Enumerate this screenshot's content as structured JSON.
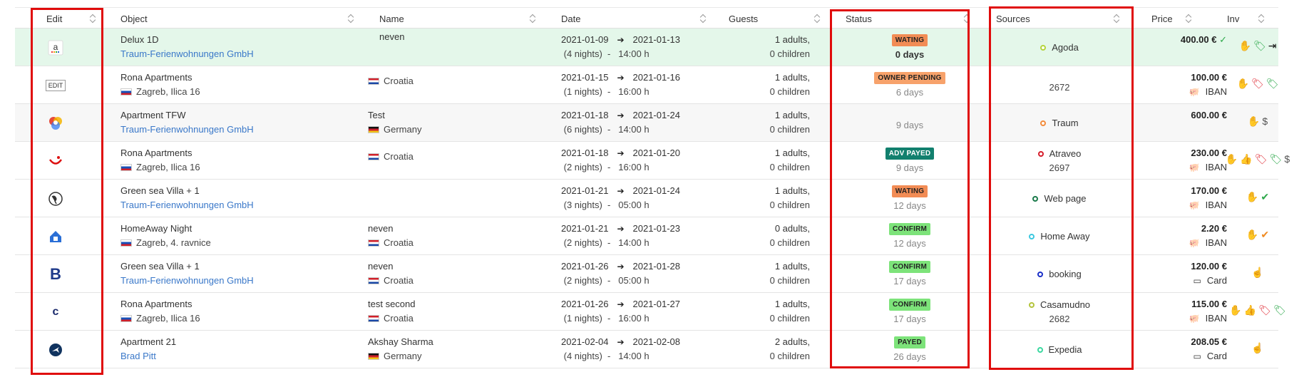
{
  "headers": {
    "edit": "Edit",
    "object": "Object",
    "name": "Name",
    "date": "Date",
    "guests": "Guests",
    "status": "Status",
    "sources": "Sources",
    "price": "Price",
    "inv": "Inv"
  },
  "rows": [
    {
      "icon": "amazon-logo-icon",
      "icon_text": "a",
      "object": "Delux 1D",
      "owner": "Traum-Ferienwohnungen GmbH",
      "owner_is_link": true,
      "name": "neven",
      "country": "",
      "date_from": "2021-01-09",
      "date_to": "2021-01-13",
      "nights": "(4 nights)",
      "time": "14:00 h",
      "adults": "1 adults,",
      "children": "0 children",
      "status_badge": "WATING",
      "badge_color": "#f28c55",
      "status_days": "0 days",
      "source": "Agoda",
      "source_color": "#b4d43c",
      "source_sub": "",
      "price": "400.00 €",
      "payment": "",
      "inv_icons": [
        "hand-icon",
        "tags-icon",
        "sign-in-icon"
      ]
    },
    {
      "icon": "edit-icon",
      "icon_text": "EDIT",
      "object": "Rona Apartments",
      "owner": "Zagreb, Ilica 16",
      "owner_is_link": false,
      "name": "",
      "country": "Croatia",
      "date_from": "2021-01-15",
      "date_to": "2021-01-16",
      "nights": "(1 nights)",
      "time": "16:00 h",
      "adults": "1 adults,",
      "children": "0 children",
      "status_badge": "OWNER PENDING",
      "badge_color": "#f7a26b",
      "status_days": "6 days",
      "source": "",
      "source_color": "",
      "source_sub": "2672",
      "price": "100.00 €",
      "payment": "IBAN",
      "inv_icons": [
        "hand-icon",
        "tag-icon",
        "tags-icon"
      ]
    },
    {
      "icon": "traum-logo-icon",
      "icon_text": "",
      "object": "Apartment TFW",
      "owner": "Traum-Ferienwohnungen GmbH",
      "owner_is_link": true,
      "name": "Test",
      "country": "Germany",
      "date_from": "2021-01-18",
      "date_to": "2021-01-24",
      "nights": "(6 nights)",
      "time": "14:00 h",
      "adults": "1 adults,",
      "children": "0 children",
      "status_badge": "",
      "badge_color": "",
      "status_days": "9 days",
      "source": "Traum",
      "source_color": "#f28c3c",
      "source_sub": "",
      "price": "600.00 €",
      "payment": "",
      "inv_icons": [
        "hand-icon",
        "money-icon"
      ]
    },
    {
      "icon": "tui-logo-icon",
      "icon_text": "",
      "object": "Rona Apartments",
      "owner": "Zagreb, Ilica 16",
      "owner_is_link": false,
      "name": "",
      "country": "Croatia",
      "date_from": "2021-01-18",
      "date_to": "2021-01-20",
      "nights": "(2 nights)",
      "time": "16:00 h",
      "adults": "1 adults,",
      "children": "0 children",
      "status_badge": "ADV PAYED",
      "badge_color": "#12806e",
      "status_days": "9 days",
      "source": "Atraveo",
      "source_color": "#d61d2b",
      "source_sub": "2697",
      "price": "230.00 €",
      "payment": "IBAN",
      "inv_icons": [
        "hand-icon",
        "thumbs-up-icon",
        "tag-icon",
        "tags-icon",
        "money-icon"
      ]
    },
    {
      "icon": "globe-icon",
      "icon_text": "",
      "object": "Green sea Villa + 1",
      "owner": "Traum-Ferienwohnungen GmbH",
      "owner_is_link": true,
      "name": "",
      "country": "",
      "date_from": "2021-01-21",
      "date_to": "2021-01-24",
      "nights": "(3 nights)",
      "time": "05:00 h",
      "adults": "1 adults,",
      "children": "0 children",
      "status_badge": "WATING",
      "badge_color": "#f28c55",
      "status_days": "12 days",
      "source": "Web page",
      "source_color": "#1a7a4a",
      "source_sub": "",
      "price": "170.00 €",
      "payment": "IBAN",
      "inv_icons": [
        "hand-icon",
        "user-check-icon"
      ]
    },
    {
      "icon": "homeaway-logo-icon",
      "icon_text": "",
      "object": "HomeAway Night",
      "owner": "Zagreb, 4. ravnice",
      "owner_is_link": false,
      "name": "neven",
      "country": "Croatia",
      "date_from": "2021-01-21",
      "date_to": "2021-01-23",
      "nights": "(2 nights)",
      "time": "14:00 h",
      "adults": "0 adults,",
      "children": "0 children",
      "status_badge": "CONFIRM",
      "badge_color": "#7de37a",
      "status_days": "12 days",
      "source": "Home Away",
      "source_color": "#3cc8e0",
      "source_sub": "",
      "price": "2.20 €",
      "payment": "IBAN",
      "inv_icons": [
        "hand-icon",
        "user-check-orange-icon"
      ]
    },
    {
      "icon": "booking-logo-icon",
      "icon_text": "B",
      "object": "Green sea Villa + 1",
      "owner": "Traum-Ferienwohnungen GmbH",
      "owner_is_link": true,
      "name": "neven",
      "country": "Croatia",
      "date_from": "2021-01-26",
      "date_to": "2021-01-28",
      "nights": "(2 nights)",
      "time": "05:00 h",
      "adults": "1 adults,",
      "children": "0 children",
      "status_badge": "CONFIRM",
      "badge_color": "#7de37a",
      "status_days": "17 days",
      "source": "booking",
      "source_color": "#1a2fc8",
      "source_sub": "",
      "price": "120.00 €",
      "payment": "Card",
      "inv_icons": [
        "hand-pointer-icon"
      ]
    },
    {
      "icon": "casamundo-logo-icon",
      "icon_text": "c",
      "object": "Rona Apartments",
      "owner": "Zagreb, Ilica 16",
      "owner_is_link": false,
      "name": "test second",
      "country": "Croatia",
      "date_from": "2021-01-26",
      "date_to": "2021-01-27",
      "nights": "(1 nights)",
      "time": "16:00 h",
      "adults": "1 adults,",
      "children": "0 children",
      "status_badge": "CONFIRM",
      "badge_color": "#7de37a",
      "status_days": "17 days",
      "source": "Casamudno",
      "source_color": "#b4c43c",
      "source_sub": "2682",
      "price": "115.00 €",
      "payment": "IBAN",
      "inv_icons": [
        "hand-icon",
        "thumbs-up-icon",
        "tag-icon",
        "tags-icon"
      ]
    },
    {
      "icon": "expedia-logo-icon",
      "icon_text": "",
      "object": "Apartment 21",
      "owner": "Brad Pitt",
      "owner_is_link": true,
      "name": "Akshay Sharma",
      "country": "Germany",
      "date_from": "2021-02-04",
      "date_to": "2021-02-08",
      "nights": "(4 nights)",
      "time": "14:00 h",
      "adults": "2 adults,",
      "children": "0 children",
      "status_badge": "PAYED",
      "badge_color": "#7de37a",
      "status_days": "26 days",
      "source": "Expedia",
      "source_color": "#3cd8a0",
      "source_sub": "",
      "price": "208.05 €",
      "payment": "Card",
      "inv_icons": [
        "hand-pointer-icon"
      ]
    }
  ],
  "colors": {
    "highlight_red": "#e00b0b",
    "link_blue": "#3a78c9",
    "active_row": "#e4f7ea"
  }
}
